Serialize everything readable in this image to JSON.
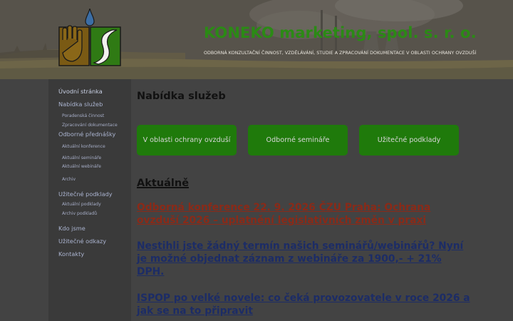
{
  "header": {
    "title": "KONEKO marketing, spol. s. r. o.",
    "subtitle": "ODBORNÁ KONZULTAČNÍ ČINNOST, VZDĚLÁVÁNÍ, STUDIE A ZPRACOVÁNÍ DOKUMENTACE V OBLASTI OCHRANY OVZDUŠÍ",
    "logo_icon": "hand-and-drop-logo-icon"
  },
  "sidebar": {
    "items": [
      {
        "label": "Úvodní stránka",
        "level": 1,
        "active": true
      },
      {
        "label": "Nabídka služeb",
        "level": 1
      },
      {
        "label": "Poradenská činnost",
        "level": 2
      },
      {
        "label": "Zpracování dokumentace",
        "level": 2
      },
      {
        "label": "Odborné přednášky",
        "level": 1
      },
      {
        "label": "Aktuální konference",
        "level": 2
      },
      {
        "label": "Aktuální semináře",
        "level": 2
      },
      {
        "label": "Aktuální webináře",
        "level": 2
      },
      {
        "label": "Archiv",
        "level": 2
      },
      {
        "label": "Užitečné podklady",
        "level": 1
      },
      {
        "label": "Aktuální podklady",
        "level": 2
      },
      {
        "label": "Archiv podkladů",
        "level": 2
      },
      {
        "label": "Kdo jsme",
        "level": 1
      },
      {
        "label": "Užitečné odkazy",
        "level": 1
      },
      {
        "label": "Kontakty",
        "level": 1
      }
    ]
  },
  "main": {
    "services_title": "Nabídka služeb",
    "service_buttons": [
      "V oblasti ochrany ovzduší",
      "Odborné semináře",
      "Užitečné podklady"
    ],
    "news_title": "Aktuálně",
    "news": [
      "Odborná konference 22. 9. 2026 ČZU Praha: Ochrana ovzduší 2026 – uplatnění legislativních změn v praxi",
      "Nestihli jste žádný termín našich seminářů/webinářů? Nyní je možné objednat záznam z webináře za 1900,- + 21% DPH.",
      "ISPOP po velké novele: co čeká provozovatele v roce 2026 a jak se na to připravit"
    ]
  },
  "colors": {
    "brand_green": "#2b8a15",
    "button_green": "#1f7a0b",
    "news_red": "#8a2a18",
    "news_blue": "#1c2c66",
    "overlay_gray": "#434343"
  }
}
